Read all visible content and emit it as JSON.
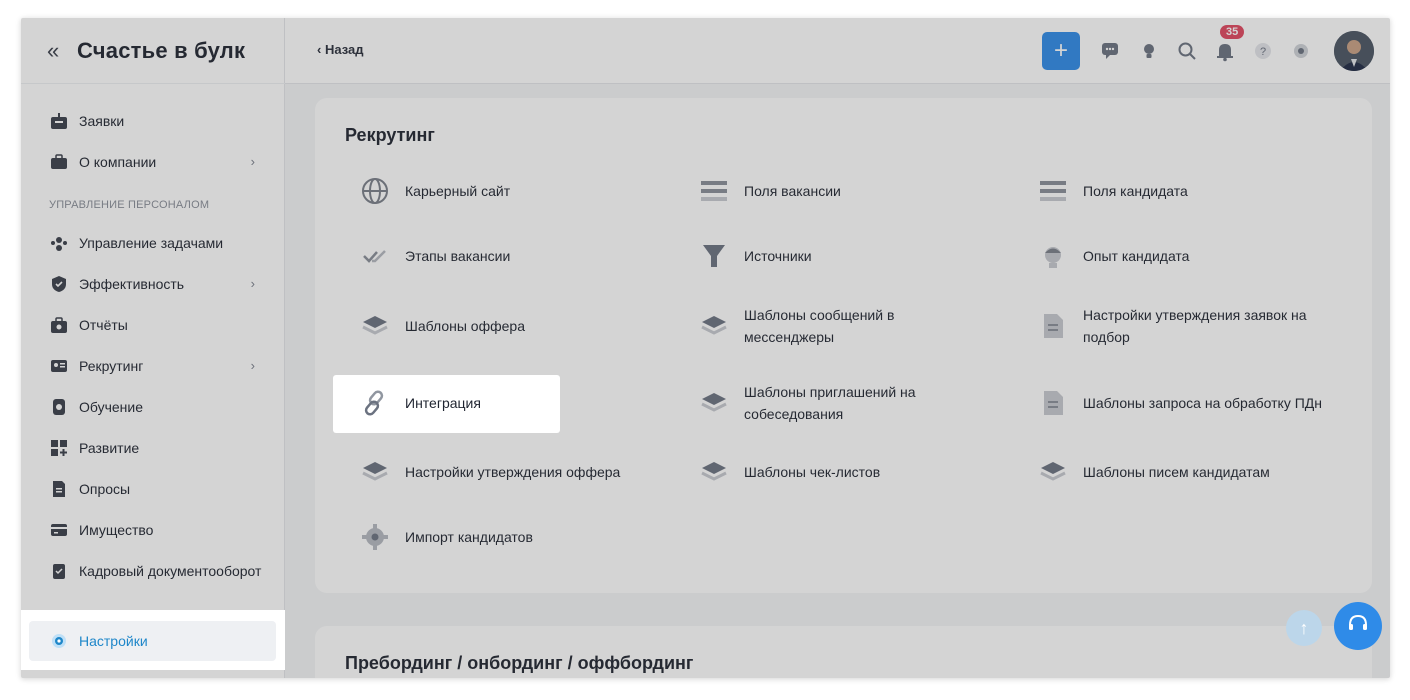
{
  "sidebar": {
    "company_name": "Счастье в булк",
    "collapse_icon": "double-chevron-left-icon",
    "items": [
      {
        "label": "Заявки",
        "icon": "inbox-icon",
        "chevron": false
      },
      {
        "label": "О компании",
        "icon": "briefcase-icon",
        "chevron": true
      }
    ],
    "section_label": "УПРАВЛЕНИЕ ПЕРСОНАЛОМ",
    "section_items": [
      {
        "label": "Управление задачами",
        "icon": "team-icon",
        "chevron": false
      },
      {
        "label": "Эффективность",
        "icon": "shield-check-icon",
        "chevron": true
      },
      {
        "label": "Отчёты",
        "icon": "reports-icon",
        "chevron": false
      },
      {
        "label": "Рекрутинг",
        "icon": "id-card-icon",
        "chevron": true
      },
      {
        "label": "Обучение",
        "icon": "learning-icon",
        "chevron": false
      },
      {
        "label": "Развитие",
        "icon": "grid-plus-icon",
        "chevron": false
      },
      {
        "label": "Опросы",
        "icon": "survey-icon",
        "chevron": false
      },
      {
        "label": "Имущество",
        "icon": "wallet-icon",
        "chevron": false
      },
      {
        "label": "Кадровый документооборот",
        "icon": "documents-icon",
        "chevron": false
      }
    ],
    "active_item": {
      "label": "Настройки",
      "icon": "gear-icon"
    },
    "chevron_glyph": "›"
  },
  "header": {
    "back_label": "Назад",
    "add_glyph": "+",
    "notifications_count": "35",
    "icons": [
      "chat-icon",
      "idea-icon",
      "search-icon",
      "bell-icon",
      "help-icon",
      "gear-icon"
    ]
  },
  "main": {
    "section_title": "Рекрутинг",
    "tiles": [
      {
        "label": "Карьерный сайт",
        "icon": "globe-icon"
      },
      {
        "label": "Поля вакансии",
        "icon": "lines-icon"
      },
      {
        "label": "Поля кандидата",
        "icon": "lines-icon"
      },
      {
        "label": "Этапы вакансии",
        "icon": "double-check-icon"
      },
      {
        "label": "Источники",
        "icon": "funnel-icon"
      },
      {
        "label": "Опыт кандидата",
        "icon": "person-icon"
      },
      {
        "label": "Шаблоны оффера",
        "icon": "layers-icon"
      },
      {
        "label": "Шаблоны сообщений в мессенджеры",
        "icon": "layers-icon"
      },
      {
        "label": "Настройки утверждения заявок на подбор",
        "icon": "document-icon"
      },
      {
        "label": "Интеграция",
        "icon": "link-icon"
      },
      {
        "label": "Шаблоны приглашений на собеседования",
        "icon": "layers-icon"
      },
      {
        "label": "Шаблоны запроса на обработку ПДн",
        "icon": "document-icon"
      },
      {
        "label": "Настройки утверждения оффера",
        "icon": "layers-icon"
      },
      {
        "label": "Шаблоны чек-листов",
        "icon": "layers-icon"
      },
      {
        "label": "Шаблоны писем кандидатам",
        "icon": "layers-icon"
      },
      {
        "label": "Импорт кандидатов",
        "icon": "gear-icon"
      }
    ],
    "section2_title": "Пребординг / онбординг / оффбординг"
  },
  "fab": {
    "scroll_up_glyph": "↑",
    "support_icon": "headset-icon"
  },
  "colors": {
    "accent": "#2f8be8",
    "active_text": "#1f87c9",
    "badge": "#e0475f",
    "overlay": "rgba(60,60,60,0.22)"
  }
}
